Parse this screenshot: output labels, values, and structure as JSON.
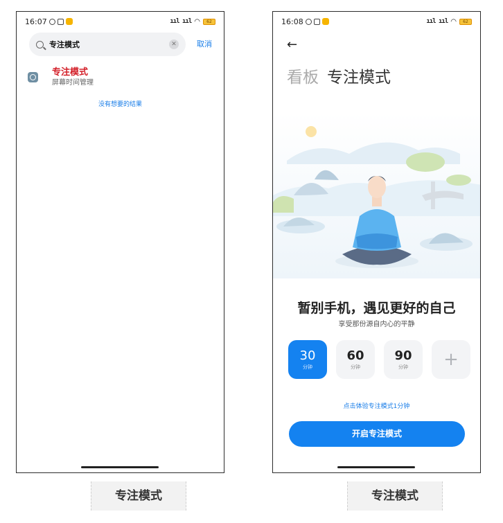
{
  "left": {
    "status": {
      "time": "16:07",
      "signal": "ᵀıl ᵀıl",
      "battery": "62"
    },
    "search": {
      "query": "专注模式",
      "cancel_label": "取消"
    },
    "result": {
      "title": "专注模式",
      "subtitle": "屏幕时间管理"
    },
    "no_more": "没有想要的结果"
  },
  "right": {
    "status": {
      "time": "16:08",
      "signal": "ᵀıl ᵀıl",
      "battery": "62"
    },
    "back_icon": "←",
    "header": {
      "parent": "看板",
      "title": "专注模式"
    },
    "slogan": "暂别手机，遇见更好的自己",
    "slogan_sub": "享受那份源自内心的平静",
    "options": [
      {
        "value": "30",
        "unit": "分钟",
        "selected": true
      },
      {
        "value": "60",
        "unit": "分钟",
        "selected": false
      },
      {
        "value": "90",
        "unit": "分钟",
        "selected": false
      },
      {
        "value": "+",
        "unit": "",
        "selected": false
      }
    ],
    "trial_link": "点击体验专注模式1分钟",
    "start_label": "开启专注模式"
  },
  "captions": {
    "left": "专注模式",
    "right": "专注模式"
  },
  "colors": {
    "accent": "#1482f0",
    "result_title": "#d31f28"
  },
  "icons": [
    "search-icon",
    "clear-icon",
    "app-icon",
    "back-arrow-icon",
    "alarm-icon",
    "nfc-icon",
    "wifi-icon",
    "battery-icon"
  ]
}
